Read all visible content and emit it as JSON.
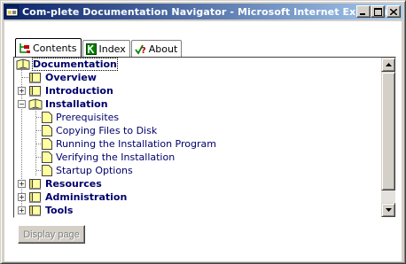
{
  "window": {
    "title": "Com-plete Documentation Navigator - Microsoft Internet Explorer",
    "minimize_label": "_",
    "maximize_label": "□",
    "close_label": "×"
  },
  "tabs": [
    {
      "label": "Contents",
      "icon": "contents-tree-icon",
      "active": true
    },
    {
      "label": "Index",
      "icon": "index-k-icon",
      "active": false
    },
    {
      "label": "About",
      "icon": "about-question-icon",
      "active": false
    }
  ],
  "tree": {
    "root": {
      "label": "Documentation",
      "expanded": true
    },
    "items": [
      {
        "label": "Overview",
        "type": "book",
        "level": 1,
        "expander": ""
      },
      {
        "label": "Introduction",
        "type": "book",
        "level": 1,
        "expander": "+"
      },
      {
        "label": "Installation",
        "type": "open-book",
        "level": 1,
        "expander": "−"
      },
      {
        "label": "Prerequisites",
        "type": "page",
        "level": 2
      },
      {
        "label": "Copying Files to Disk",
        "type": "page",
        "level": 2
      },
      {
        "label": "Running the Installation Program",
        "type": "page",
        "level": 2
      },
      {
        "label": "Verifying the Installation",
        "type": "page",
        "level": 2
      },
      {
        "label": "Startup Options",
        "type": "page",
        "level": 2
      },
      {
        "label": "Resources",
        "type": "book",
        "level": 1,
        "expander": "+"
      },
      {
        "label": "Administration",
        "type": "book",
        "level": 1,
        "expander": "+"
      },
      {
        "label": "Tools",
        "type": "book",
        "level": 1,
        "expander": "+"
      }
    ]
  },
  "footer": {
    "display_button_label": "Display page"
  }
}
